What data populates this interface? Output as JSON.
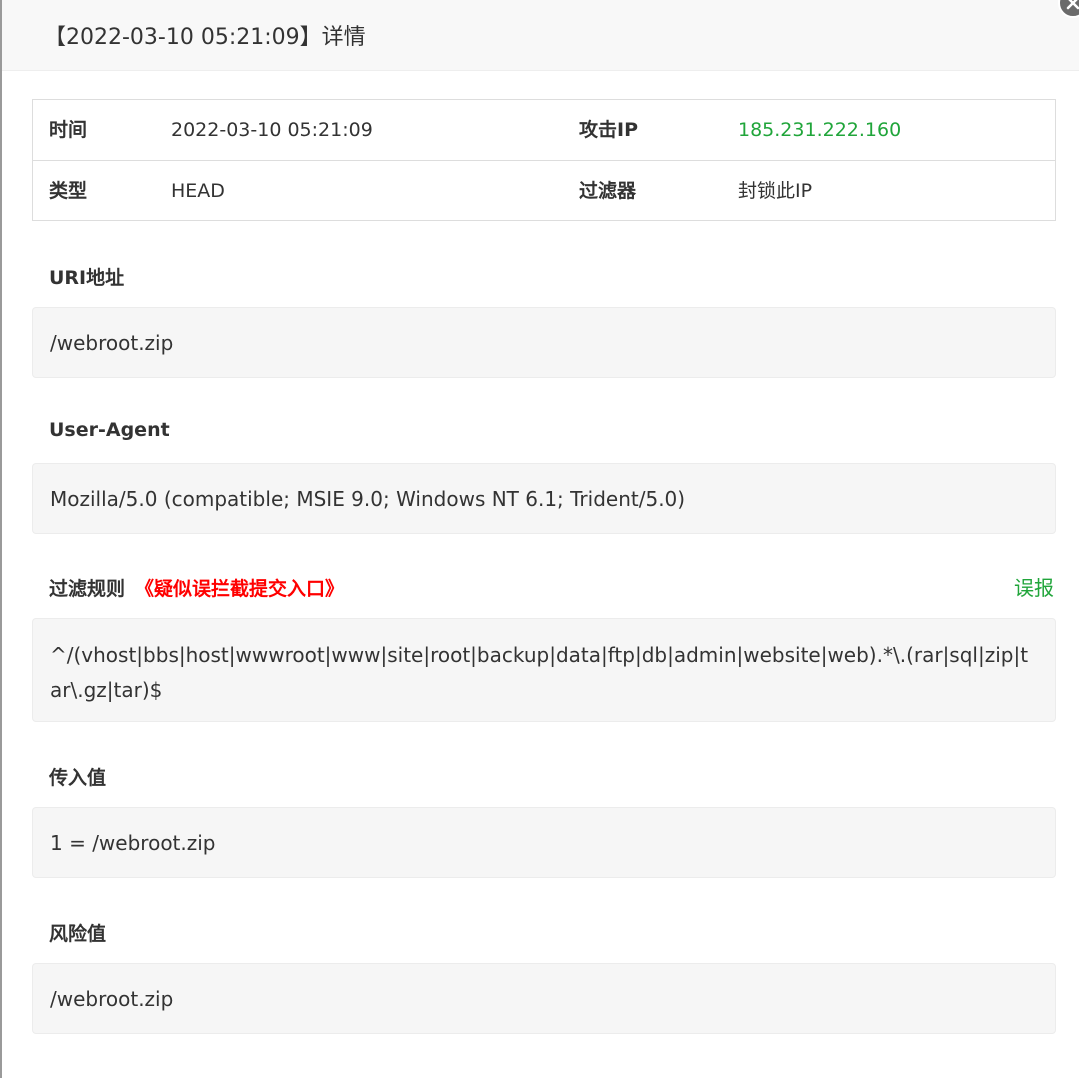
{
  "dialog": {
    "title": "【2022-03-10 05:21:09】详情",
    "close_icon": "close-icon"
  },
  "info": {
    "time_label": "时间",
    "time_value": "2022-03-10 05:21:09",
    "ip_label": "攻击IP",
    "ip_value": "185.231.222.160",
    "type_label": "类型",
    "type_value": "HEAD",
    "filter_label": "过滤器",
    "filter_value": "封锁此IP"
  },
  "uri": {
    "label": "URI地址",
    "value": "/webroot.zip"
  },
  "user_agent": {
    "label": "User-Agent",
    "value": "Mozilla/5.0 (compatible; MSIE 9.0; Windows NT 6.1; Trident/5.0)"
  },
  "rule": {
    "label": "过滤规则",
    "warn_link": "《疑似误拦截提交入口》",
    "report_link": "误报",
    "value": "^/(vhost|bbs|host|wwwroot|www|site|root|backup|data|ftp|db|admin|website|web).*\\.(rar|sql|zip|tar\\.gz|tar)$"
  },
  "input_value": {
    "label": "传入值",
    "value": "1 = /webroot.zip"
  },
  "risk_value": {
    "label": "风险值",
    "value": "/webroot.zip"
  },
  "colors": {
    "accent_green": "#20a53a",
    "warn_red": "#ff0000"
  }
}
